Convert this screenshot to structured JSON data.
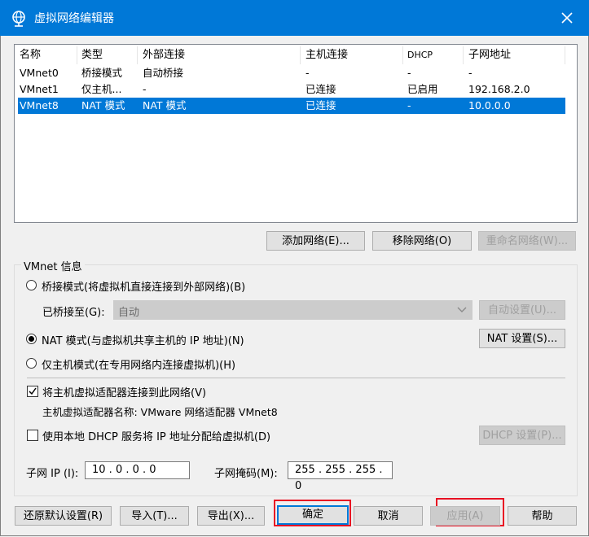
{
  "window": {
    "title": "虚拟网络编辑器",
    "close_glyph": "✕"
  },
  "colors": {
    "titlebar": "#0078d7",
    "selection": "#0078d7",
    "highlight_box": "#e81123"
  },
  "table": {
    "columns": [
      "名称",
      "类型",
      "外部连接",
      "主机连接",
      "DHCP",
      "子网地址"
    ],
    "rows": [
      {
        "name": "VMnet0",
        "type": "桥接模式",
        "external": "自动桥接",
        "host": "-",
        "dhcp": "-",
        "subnet": "-",
        "selected": false
      },
      {
        "name": "VMnet1",
        "type": "仅主机...",
        "external": "-",
        "host": "已连接",
        "dhcp": "已启用",
        "subnet": "192.168.2.0",
        "selected": false
      },
      {
        "name": "VMnet8",
        "type": "NAT 模式",
        "external": "NAT 模式",
        "host": "已连接",
        "dhcp": "-",
        "subnet": "10.0.0.0",
        "selected": true
      }
    ]
  },
  "network_buttons": {
    "add": "添加网络(E)...",
    "remove": "移除网络(O)",
    "rename": "重命名网络(W)..."
  },
  "vmnet_info": {
    "label": "VMnet 信息",
    "bridged_radio": "桥接模式(将虚拟机直接连接到外部网络)(B)",
    "bridged_to_label": "已桥接至(G):",
    "bridged_to_value": "自动",
    "auto_settings": "自动设置(U)...",
    "nat_radio": "NAT 模式(与虚拟机共享主机的 IP 地址)(N)",
    "nat_settings": "NAT 设置(S)...",
    "hostonly_radio": "仅主机模式(在专用网络内连接虚拟机)(H)",
    "selected_mode": "nat",
    "connect_adapter_check": "将主机虚拟适配器连接到此网络(V)",
    "connect_adapter_checked": true,
    "adapter_name": "主机虚拟适配器名称: VMware 网络适配器 VMnet8",
    "dhcp_check": "使用本地 DHCP 服务将 IP 地址分配给虚拟机(D)",
    "dhcp_checked": false,
    "dhcp_settings": "DHCP 设置(P)...",
    "subnet_ip_label": "子网 IP (I):",
    "subnet_ip_value": "10 . 0 . 0 . 0",
    "subnet_mask_label": "子网掩码(M):",
    "subnet_mask_value": "255 . 255 . 255 . 0"
  },
  "footer": {
    "restore": "还原默认设置(R)",
    "import": "导入(T)...",
    "export": "导出(X)...",
    "ok": "确定",
    "cancel": "取消",
    "apply": "应用(A)",
    "help": "帮助"
  }
}
